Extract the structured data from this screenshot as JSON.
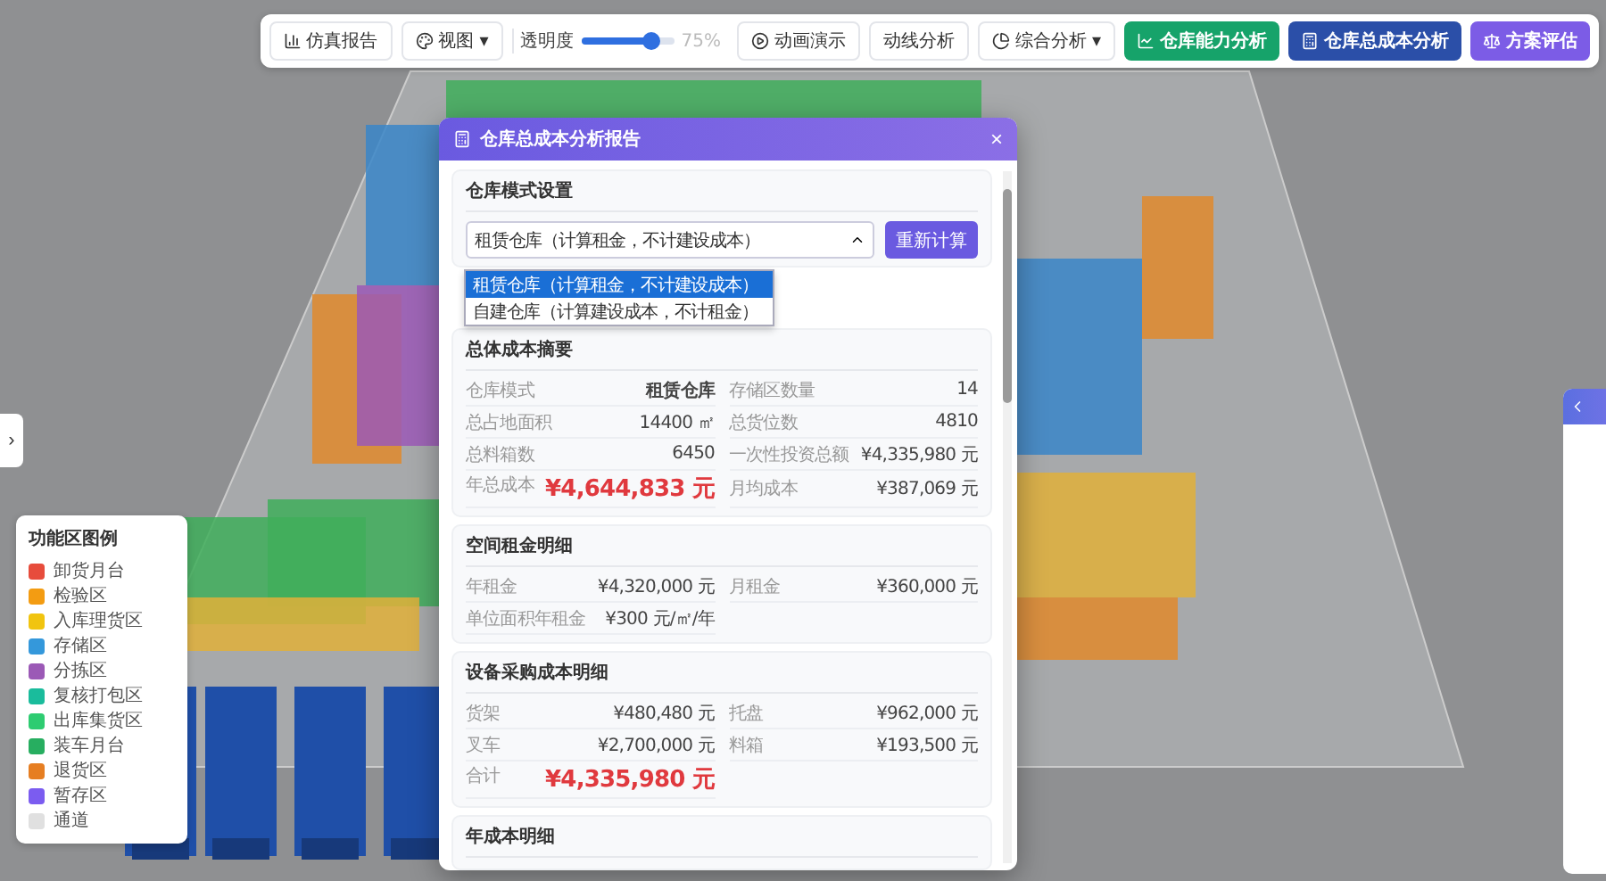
{
  "toolbar": {
    "items": [
      {
        "kind": "button",
        "label": "仿真报告"
      },
      {
        "kind": "menu",
        "label": "视图",
        "caret": "▾"
      },
      {
        "kind": "slider",
        "label": "透明度",
        "level": 0.75,
        "reading": "75%"
      },
      {
        "kind": "button",
        "label": "动画演示"
      },
      {
        "kind": "plain",
        "label": "动线分析"
      },
      {
        "kind": "menu",
        "label": "综合分析",
        "caret": "▾"
      },
      {
        "kind": "action",
        "label": "仓库能力分析",
        "color": "#16a36a"
      },
      {
        "kind": "action",
        "label": "仓库总成本分析",
        "color": "#2b4fa8"
      },
      {
        "kind": "action",
        "label": "方案评估",
        "color": "#7c5ce6"
      }
    ]
  },
  "side_toggle": {
    "label": "›"
  },
  "legend": {
    "title": "功能区图例",
    "items": [
      {
        "label": "卸货月台",
        "color": "#e74c3c"
      },
      {
        "label": "检验区",
        "color": "#f39c12"
      },
      {
        "label": "入库理货区",
        "color": "#f1c40f"
      },
      {
        "label": "存储区",
        "color": "#3498db"
      },
      {
        "label": "分拣区",
        "color": "#9b59b6"
      },
      {
        "label": "复核打包区",
        "color": "#1abc9c"
      },
      {
        "label": "出库集货区",
        "color": "#2ecc71"
      },
      {
        "label": "装车月台",
        "color": "#27ae60"
      },
      {
        "label": "退货区",
        "color": "#e67e22"
      },
      {
        "label": "暂存区",
        "color": "#7b5cf0"
      },
      {
        "label": "通道",
        "color": "#e0e0e0"
      }
    ]
  },
  "dialog": {
    "title": "仓库总成本分析报告",
    "close": "×",
    "mode": {
      "title": "仓库模式设置",
      "value": "租赁仓库（计算租金，不计建设成本）",
      "button": "重新计算",
      "expanded": true,
      "options": [
        {
          "label": "租赁仓库（计算租金，不计建设成本）",
          "selected": true
        },
        {
          "label": "自建仓库（计算建设成本，不计租金）",
          "selected": false
        }
      ]
    },
    "sections": [
      {
        "title": "总体成本摘要",
        "fields": [
          {
            "label": "仓库模式",
            "value": "租赁仓库",
            "kind": "bold"
          },
          {
            "label": "存储区数量",
            "value": "14",
            "kind": "plain"
          },
          {
            "label": "总占地面积",
            "value": "14400 ㎡",
            "kind": "plain"
          },
          {
            "label": "总货位数",
            "value": "4810",
            "kind": "plain"
          },
          {
            "label": "总料箱数",
            "value": "6450",
            "kind": "plain"
          },
          {
            "label": "一次性投资总额",
            "value": "¥4,335,980 元",
            "kind": "plain"
          },
          {
            "label": "年总成本",
            "value": "¥4,644,833 元",
            "kind": "big"
          },
          {
            "label": "月均成本",
            "value": "¥387,069 元",
            "kind": "plain"
          }
        ]
      },
      {
        "title": "空间租金明细",
        "fields": [
          {
            "label": "年租金",
            "value": "¥4,320,000 元",
            "kind": "plain"
          },
          {
            "label": "月租金",
            "value": "¥360,000 元",
            "kind": "plain"
          },
          {
            "label": "单位面积年租金",
            "value": "¥300 元/㎡/年",
            "kind": "plain"
          }
        ]
      },
      {
        "title": "设备采购成本明细",
        "fields": [
          {
            "label": "货架",
            "value": "¥480,480 元",
            "kind": "plain"
          },
          {
            "label": "托盘",
            "value": "¥962,000 元",
            "kind": "plain"
          },
          {
            "label": "叉车",
            "value": "¥2,700,000 元",
            "kind": "plain"
          },
          {
            "label": "料箱",
            "value": "¥193,500 元",
            "kind": "plain"
          },
          {
            "label": "合计",
            "value": "¥4,335,980 元",
            "kind": "big"
          }
        ]
      },
      {
        "title": "年成本明细"
      }
    ]
  }
}
